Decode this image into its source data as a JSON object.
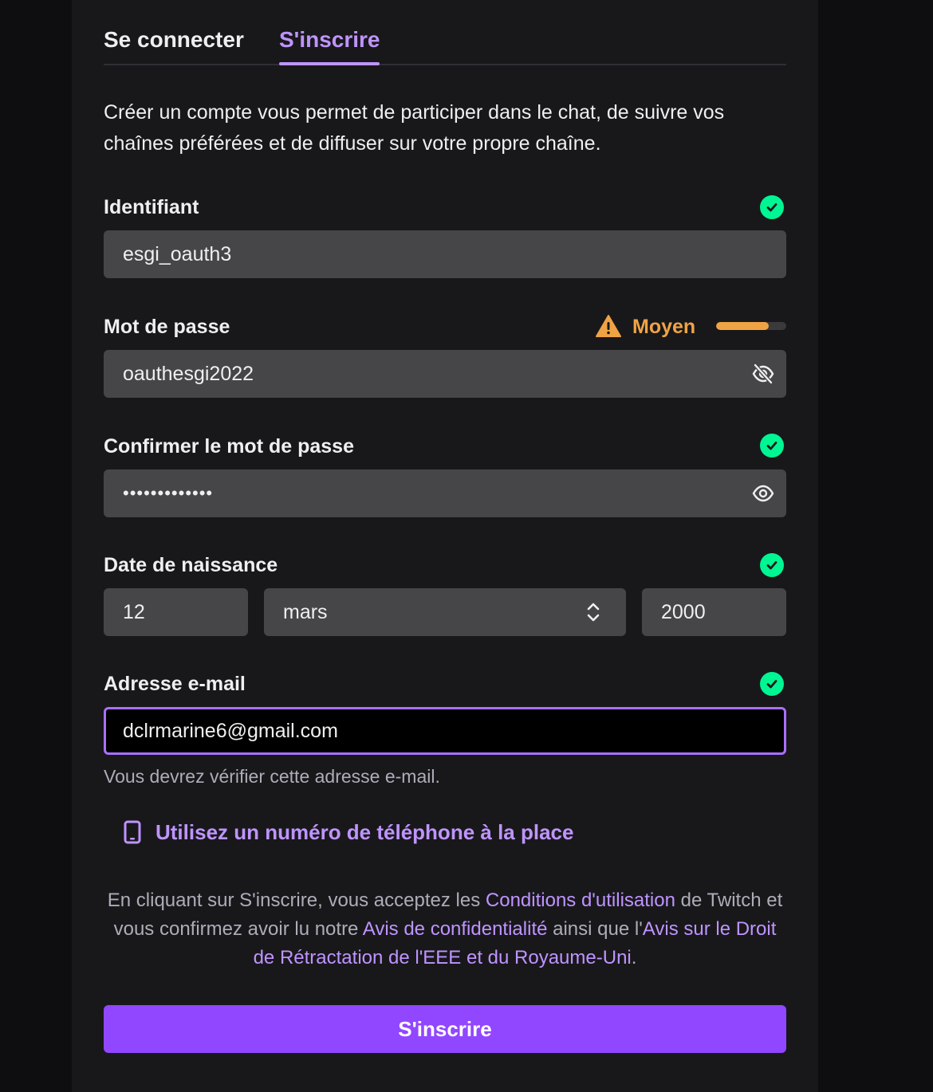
{
  "tabs": {
    "login": "Se connecter",
    "register": "S'inscrire"
  },
  "intro": "Créer un compte vous permet de participer dans le chat, de suivre vos chaînes préférées et de diffuser sur votre propre chaîne.",
  "username": {
    "label": "Identifiant",
    "value": "esgi_oauth3"
  },
  "password": {
    "label": "Mot de passe",
    "value": "oauthesgi2022",
    "strength_label": "Moyen",
    "strength_level": 0.75
  },
  "confirm": {
    "label": "Confirmer le mot de passe",
    "value": "•••••••••••••"
  },
  "birthdate": {
    "label": "Date de naissance",
    "day": "12",
    "month": "mars",
    "year": "2000"
  },
  "email": {
    "label": "Adresse e-mail",
    "value": "dclrmarine6@gmail.com",
    "hint": "Vous devrez vérifier cette adresse e-mail."
  },
  "phone_link": "Utilisez un numéro de téléphone à la place",
  "terms": {
    "t1": "En cliquant sur S'inscrire, vous acceptez les ",
    "l1": "Conditions d'utilisation",
    "t2": " de Twitch et vous confirmez avoir lu notre ",
    "l2": "Avis de confidentialité",
    "t3": " ainsi que l'",
    "l3": "Avis sur le Droit de Rétractation de l'EEE et du Royaume-Uni",
    "t4": "."
  },
  "submit": "S'inscrire",
  "colors": {
    "accent": "#9147ff",
    "accent_text": "#bf94ff",
    "success": "#00f593",
    "warning": "#f0a344",
    "background": "#18181b",
    "field": "#464649"
  }
}
